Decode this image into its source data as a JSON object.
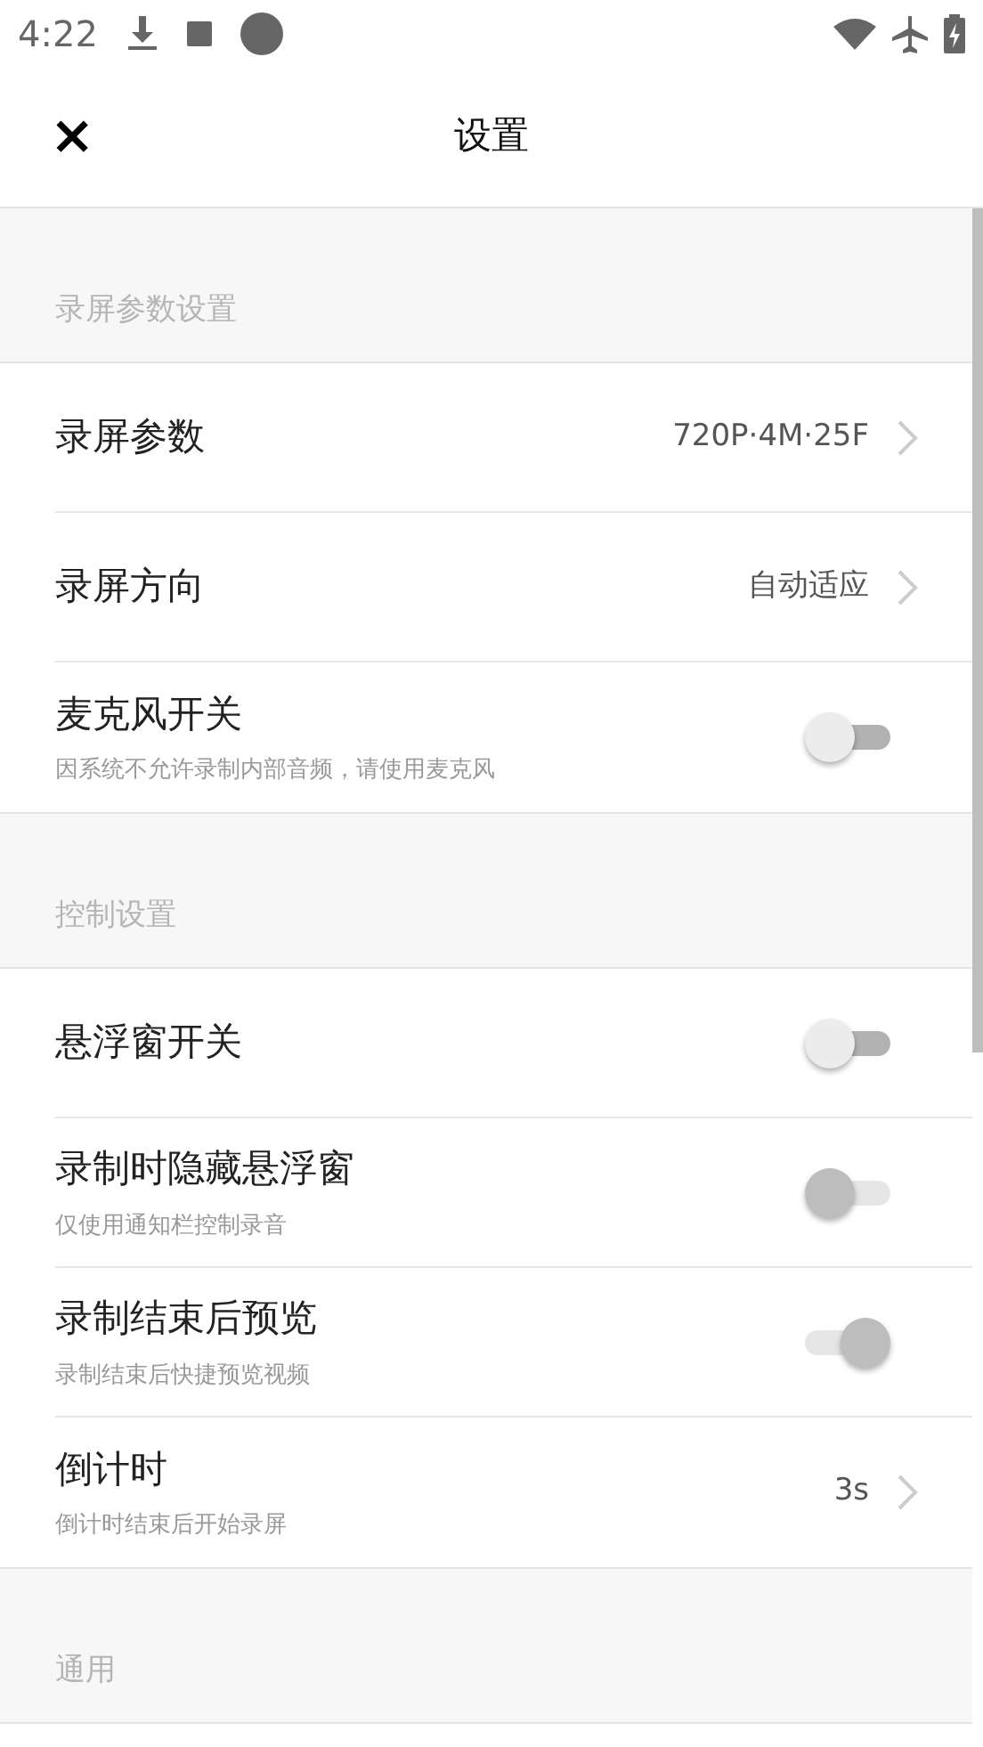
{
  "status_bar": {
    "time": "4:22"
  },
  "app_bar": {
    "close": "×",
    "title": "设置"
  },
  "sections": [
    {
      "header": "录屏参数设置",
      "rows": [
        {
          "kind": "link",
          "title": "录屏参数",
          "value": "720P·4M·25F"
        },
        {
          "kind": "link",
          "title": "录屏方向",
          "value": "自动适应"
        },
        {
          "kind": "toggle",
          "title": "麦克风开关",
          "subtitle": "因系统不允许录制内部音频，请使用麦克风",
          "on": false,
          "disabled": false
        }
      ]
    },
    {
      "header": "控制设置",
      "rows": [
        {
          "kind": "toggle",
          "title": "悬浮窗开关",
          "on": false,
          "disabled": false
        },
        {
          "kind": "toggle",
          "title": "录制时隐藏悬浮窗",
          "subtitle": "仅使用通知栏控制录音",
          "on": false,
          "disabled": true
        },
        {
          "kind": "toggle",
          "title": "录制结束后预览",
          "subtitle": "录制结束后快捷预览视频",
          "on": true,
          "disabled": true
        },
        {
          "kind": "link",
          "title": "倒计时",
          "subtitle": "倒计时结束后开始录屏",
          "value": "3s"
        }
      ]
    },
    {
      "header": "通用"
    }
  ]
}
